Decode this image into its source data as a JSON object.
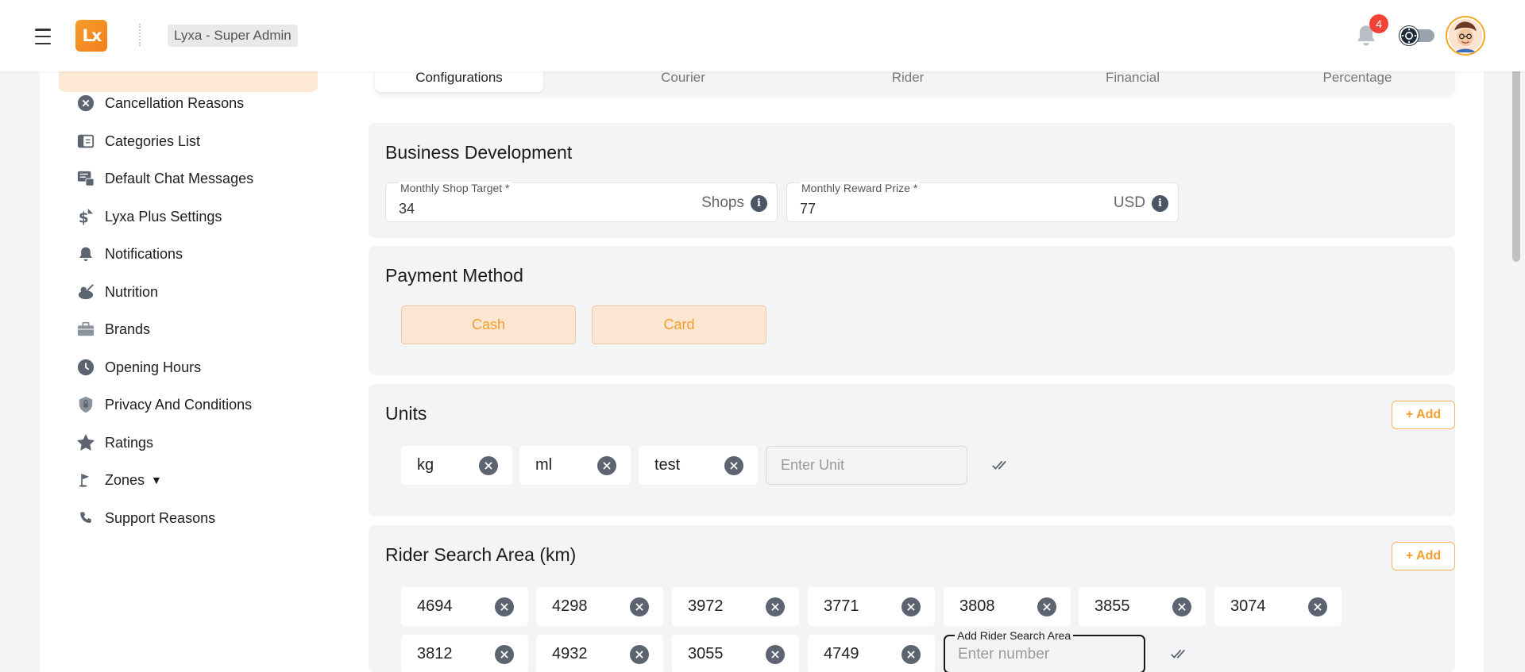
{
  "header": {
    "logo_text": "Lx",
    "role_label": "Lyxa - Super Admin",
    "notification_count": "4"
  },
  "sidebar": {
    "items": [
      {
        "label": "Cancellation Reasons",
        "icon": "cancel-circle-icon"
      },
      {
        "label": "Categories List",
        "icon": "categories-list-icon"
      },
      {
        "label": "Default Chat Messages",
        "icon": "chat-messages-icon"
      },
      {
        "label": "Lyxa Plus Settings",
        "icon": "dollar-icon"
      },
      {
        "label": "Notifications",
        "icon": "bell-icon"
      },
      {
        "label": "Nutrition",
        "icon": "nutrition-icon"
      },
      {
        "label": "Brands",
        "icon": "briefcase-icon"
      },
      {
        "label": "Opening Hours",
        "icon": "clock-icon"
      },
      {
        "label": "Privacy And Conditions",
        "icon": "shield-lock-icon"
      },
      {
        "label": "Ratings",
        "icon": "star-icon"
      },
      {
        "label": "Zones",
        "icon": "zones-flag-icon",
        "caret": "▼"
      },
      {
        "label": "Support Reasons",
        "icon": "phone-icon"
      }
    ]
  },
  "tabs": [
    {
      "label": "Configurations",
      "active": true
    },
    {
      "label": "Courier",
      "active": false
    },
    {
      "label": "Rider",
      "active": false
    },
    {
      "label": "Financial",
      "active": false
    },
    {
      "label": "Percentage",
      "active": false
    }
  ],
  "business_development": {
    "title": "Business Development",
    "shop_target": {
      "label": "Monthly Shop Target *",
      "value": "34",
      "suffix": "Shops"
    },
    "reward_prize": {
      "label": "Monthly Reward Prize *",
      "value": "77",
      "suffix": "USD"
    }
  },
  "payment_method": {
    "title": "Payment Method",
    "options": [
      "Cash",
      "Card"
    ]
  },
  "units": {
    "title": "Units",
    "add_label": "+ Add",
    "items": [
      "kg",
      "ml",
      "test"
    ],
    "input_placeholder": "Enter Unit"
  },
  "rider_search": {
    "title": "Rider Search Area (km)",
    "add_label": "+ Add",
    "row1": [
      "4694",
      "4298",
      "3972",
      "3771",
      "3808",
      "3855",
      "3074"
    ],
    "row2": [
      "3812",
      "4932",
      "3055",
      "4749"
    ],
    "input_label": "Add Rider Search Area",
    "input_placeholder": "Enter number"
  },
  "colors": {
    "accent": "#f59e2b",
    "accent_light": "#fde9d5",
    "badge": "#f44336"
  }
}
